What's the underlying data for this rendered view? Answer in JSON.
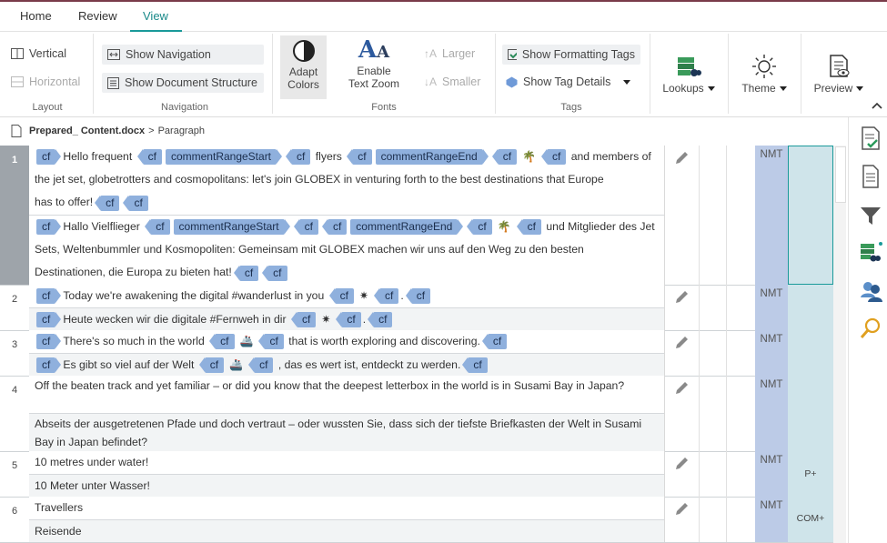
{
  "tabs": [
    "Home",
    "Review",
    "View"
  ],
  "ribbon": {
    "layout": {
      "vertical": "Vertical",
      "horizontal": "Horizontal",
      "label": "Layout"
    },
    "navigation": {
      "show_navigation": "Show Navigation",
      "show_doc_structure": "Show Document Structure",
      "label": "Navigation"
    },
    "fonts": {
      "adapt_1": "Adapt",
      "adapt_2": "Colors",
      "zoom_1": "Enable",
      "zoom_2": "Text Zoom",
      "larger": "Larger",
      "smaller": "Smaller",
      "label": "Fonts"
    },
    "tags": {
      "show_formatting": "Show Formatting Tags",
      "show_details": "Show Tag Details",
      "label": "Tags"
    },
    "lookups": "Lookups",
    "theme": "Theme",
    "preview": "Preview"
  },
  "breadcrumb": {
    "file": "Prepared_ Content.docx",
    "sep": ">",
    "current": "Paragraph"
  },
  "rows": [
    {
      "num": "1",
      "nmt": "NMT",
      "status": ""
    },
    {
      "num": "2",
      "nmt": "NMT",
      "status": ""
    },
    {
      "num": "3",
      "nmt": "NMT",
      "status": ""
    },
    {
      "num": "4",
      "nmt": "NMT",
      "status": ""
    },
    {
      "num": "5",
      "nmt": "NMT",
      "status": "P+"
    },
    {
      "num": "6",
      "nmt": "NMT",
      "status": "COM+"
    }
  ],
  "seg": {
    "tag_cf": "cf",
    "tag_crs": "commentRangeStart",
    "tag_cre": "commentRangeEnd",
    "r1s_a": "Hello frequent",
    "r1s_b": "flyers",
    "r1s_c": "and members of",
    "r1s_d": "the jet set, globetrotters and cosmopolitans: let's join GLOBEX in venturing forth to the best destinations that Europe",
    "r1s_e": "has to offer!",
    "r1t_a": "Hallo Vielflieger",
    "r1t_b": "und Mitglieder des Jet",
    "r1t_c": "Sets, Weltenbummler und Kosmopoliten: Gemeinsam mit GLOBEX machen wir uns auf den Weg zu den besten",
    "r1t_d": "Destinationen, die Europa zu bieten hat!",
    "r2s": "Today we're awakening the digital #wanderlust in you",
    "r2t": "Heute wecken wir die digitale #Fernweh in dir",
    "dot": ".",
    "r3s_a": "There's so much in the world",
    "r3s_b": "that is worth exploring and discovering.",
    "r3t_a": "Es gibt so viel auf der Welt",
    "r3t_b": ", das es wert ist, entdeckt zu werden.",
    "r4s": "Off the beaten track and yet familiar – or did you know that the deepest letterbox in the world is in Susami Bay in Japan?",
    "r4t": "Abseits der ausgetretenen Pfade und doch vertraut – oder wussten Sie, dass sich der tiefste Briefkasten der Welt in Susami Bay in Japan befindet?",
    "r5s": "10 metres under water!",
    "r5t": "10 Meter unter Wasser!",
    "r6s": "Travellers",
    "r6t": "Reisende"
  },
  "colors": {
    "accent": "#1a9a9a",
    "tag": "#8fb0dd",
    "nmt": "#bccbe7",
    "status": "#cfe4ea"
  }
}
